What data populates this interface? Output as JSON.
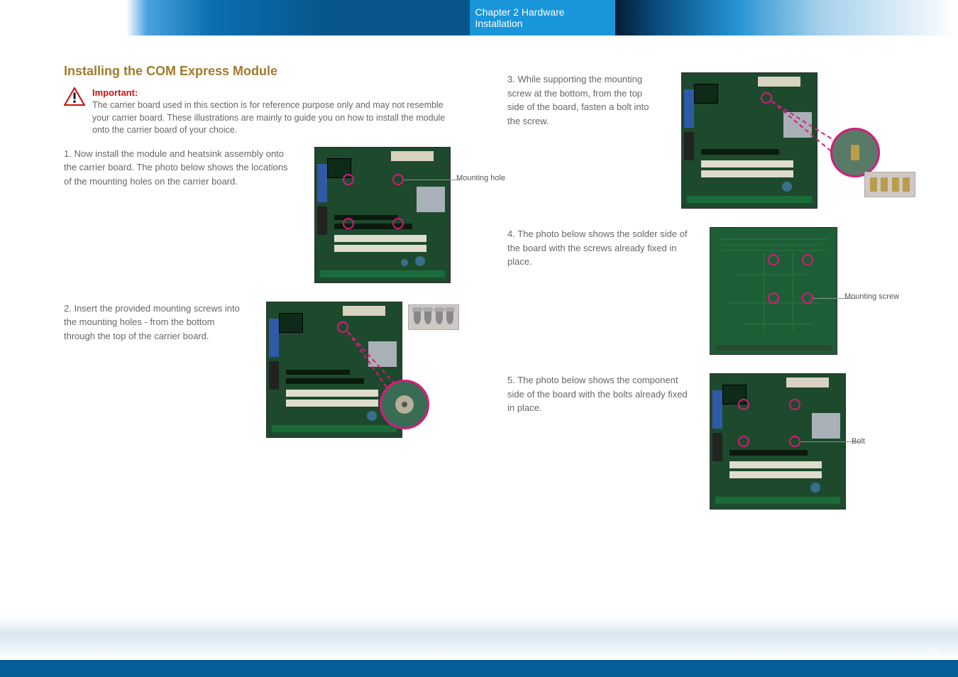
{
  "header": {
    "chapter_label": "Chapter 2 Hardware Installation"
  },
  "left": {
    "section_title": "Installing the COM Express Module",
    "important_label": "Important:",
    "important_text": "The carrier board used in this section is for reference purpose only and may not resemble your carrier board. These illustrations are mainly to guide you on how to install the module onto the carrier board of your choice.",
    "step1_num": "1.",
    "step1_text": "Now install the module and heatsink assembly onto the carrier board. The photo below shows the locations of the mounting holes on the carrier board.",
    "step1_label": "Mounting hole",
    "step2_num": "2.",
    "step2_text": "Insert the provided mounting screws into the mounting holes - from the bottom through the top of the carrier board."
  },
  "right": {
    "step3_num": "3.",
    "step3_text": "While supporting the mounting screw at the bottom, from the top side of the board, fasten a bolt into the screw.",
    "step4_num": "4.",
    "step4_text": "The photo below shows the solder side of the board with the screws already fixed in place.",
    "step4_label": "Mounting screw",
    "step5_num": "5.",
    "step5_text": "The photo below shows the component side of the board with the bolts already fixed in place.",
    "step5_label": "Bolt"
  },
  "page_number": "19"
}
